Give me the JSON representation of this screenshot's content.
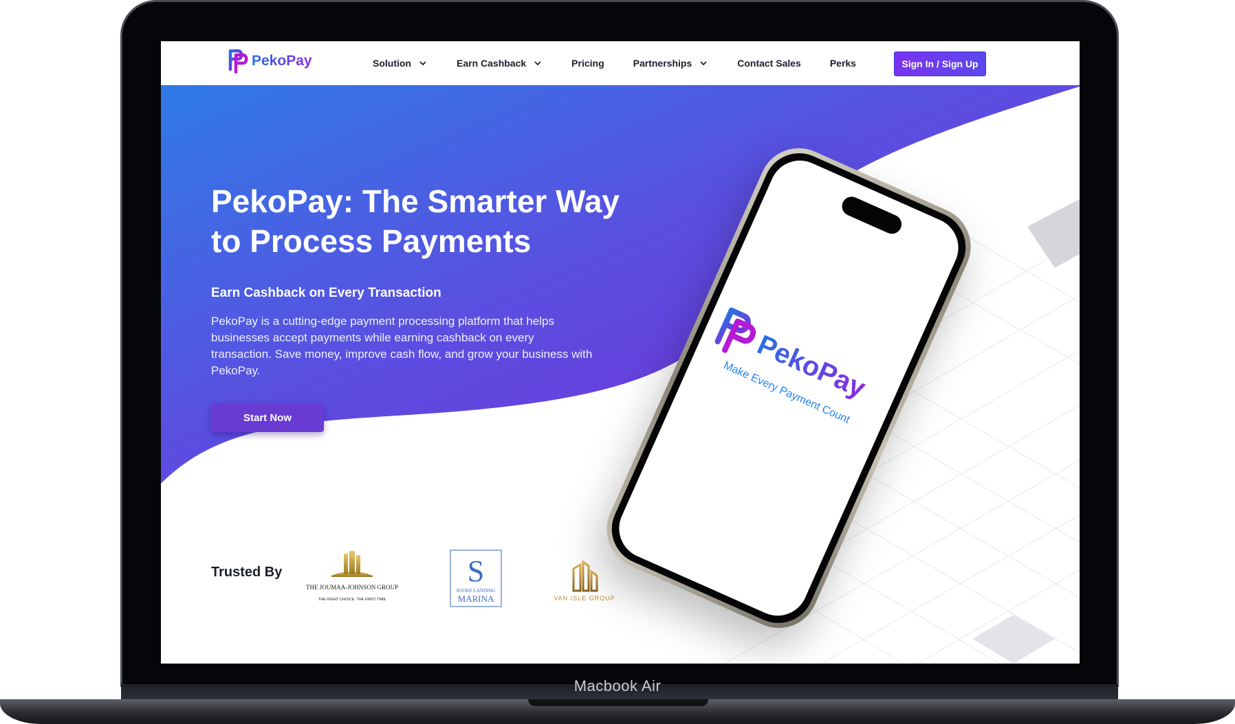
{
  "device": {
    "label": "Macbook Air"
  },
  "brand": {
    "name": "PekoPay",
    "logo_icon": "pp-monogram-icon",
    "gradient": [
      "#2a6fe0",
      "#8a2be2"
    ]
  },
  "nav": {
    "items": [
      {
        "label": "Solution",
        "has_dropdown": true
      },
      {
        "label": "Earn Cashback",
        "has_dropdown": true
      },
      {
        "label": "Pricing",
        "has_dropdown": false
      },
      {
        "label": "Partnerships",
        "has_dropdown": true
      },
      {
        "label": "Contact Sales",
        "has_dropdown": false
      },
      {
        "label": "Perks",
        "has_dropdown": false
      }
    ],
    "signin_label": "Sign In / Sign Up"
  },
  "hero": {
    "title": "PekoPay: The Smarter Way to Process Payments",
    "subtitle": "Earn Cashback on Every Transaction",
    "description": "PekoPay is a cutting-edge payment processing platform that helps businesses accept payments while earning cashback on every transaction. Save money, improve cash flow, and grow your business with PekoPay.",
    "cta_label": "Start Now",
    "colors": {
      "gradient_start": "#2f7be6",
      "gradient_mid": "#5a4fe0",
      "gradient_end": "#7a28d8"
    }
  },
  "phone": {
    "brand": "PekoPay",
    "tagline": "Make Every Payment Count"
  },
  "trusted": {
    "label": "Trusted By",
    "logos": [
      {
        "name": "THE JOUMAA-JOHNSON GROUP",
        "tagline": "THE RIGHT CHOICE. THE FIRST TIME"
      },
      {
        "name": "MARINA",
        "top_text": "SOOKE LANDING",
        "letter": "S"
      },
      {
        "name": "VAN ISLE GROUP"
      }
    ]
  }
}
